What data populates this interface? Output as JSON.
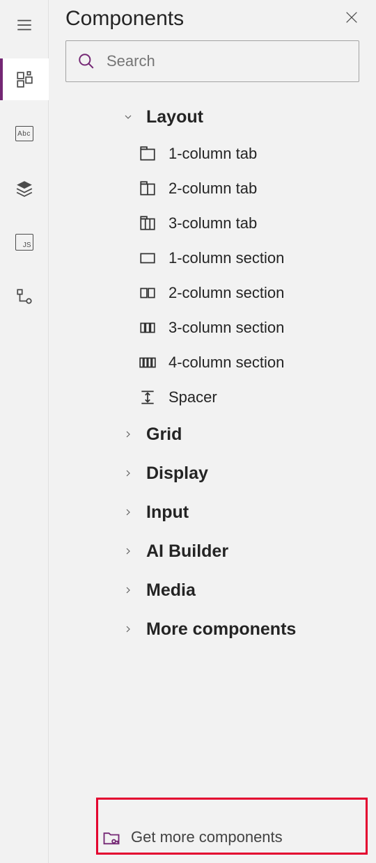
{
  "panel": {
    "title": "Components"
  },
  "search": {
    "placeholder": "Search"
  },
  "groups": {
    "layout": {
      "label": "Layout",
      "items": [
        {
          "label": "1-column tab"
        },
        {
          "label": "2-column tab"
        },
        {
          "label": "3-column tab"
        },
        {
          "label": "1-column section"
        },
        {
          "label": "2-column section"
        },
        {
          "label": "3-column section"
        },
        {
          "label": "4-column section"
        },
        {
          "label": "Spacer"
        }
      ]
    },
    "grid": {
      "label": "Grid"
    },
    "display": {
      "label": "Display"
    },
    "input": {
      "label": "Input"
    },
    "ai": {
      "label": "AI Builder"
    },
    "media": {
      "label": "Media"
    },
    "more": {
      "label": "More components"
    }
  },
  "footer": {
    "label": "Get more components"
  }
}
